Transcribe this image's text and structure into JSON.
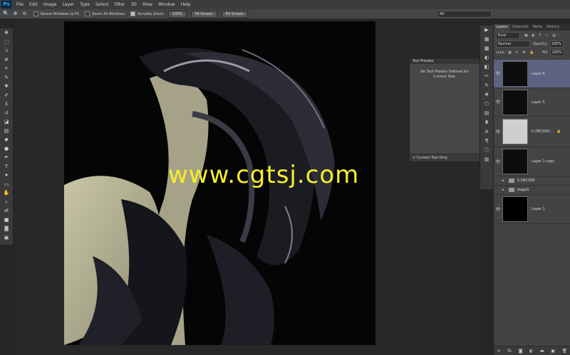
{
  "app": {
    "logo": "Ps"
  },
  "menu": [
    "File",
    "Edit",
    "Image",
    "Layer",
    "Type",
    "Select",
    "Filter",
    "3D",
    "View",
    "Window",
    "Help"
  ],
  "options": {
    "resize_windows": "Resize Windows to Fit",
    "zoom_all": "Zoom All Windows",
    "scrubby_zoom": "Scrubby Zoom",
    "btn_100": "100%",
    "btn_fit": "Fit Screen",
    "btn_fill": "Fill Screen",
    "workspace": "All"
  },
  "watermark": "www.cgtsj.com",
  "tool_presets": {
    "title": "Tool Presets",
    "message": "No Tool Presets Defined for Current Tool.",
    "current_tool_only": "Current Tool Only"
  },
  "layers_panel": {
    "tabs": [
      "Layers",
      "Channels",
      "Paths",
      "History"
    ],
    "kind": "Kind",
    "blend_mode": "Normal",
    "opacity_label": "Opacity:",
    "opacity": "100%",
    "lock_label": "Lock:",
    "fill_label": "Fill:",
    "fill": "100%",
    "layers": [
      {
        "name": "Layer 6"
      },
      {
        "name": "Layer 5"
      },
      {
        "name": "U DECIDE!..."
      },
      {
        "name": "Layer 1 copy"
      },
      {
        "name": "U DECIDE!"
      },
      {
        "name": "stage1"
      },
      {
        "name": "Layer 1"
      }
    ]
  }
}
